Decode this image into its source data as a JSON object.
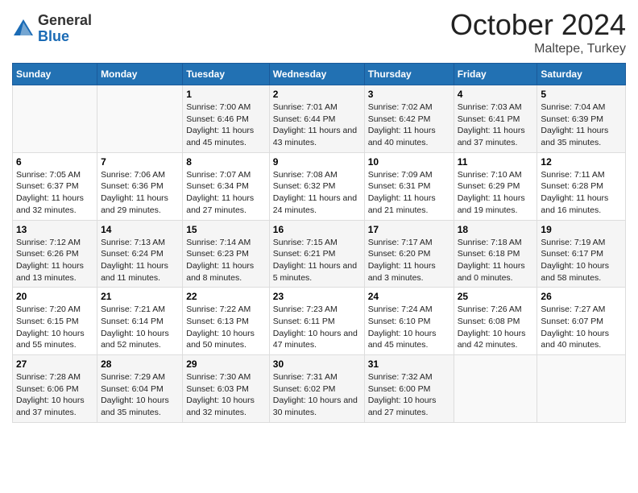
{
  "header": {
    "logo_general": "General",
    "logo_blue": "Blue",
    "month": "October 2024",
    "location": "Maltepe, Turkey"
  },
  "days_of_week": [
    "Sunday",
    "Monday",
    "Tuesday",
    "Wednesday",
    "Thursday",
    "Friday",
    "Saturday"
  ],
  "weeks": [
    [
      {
        "day": "",
        "info": ""
      },
      {
        "day": "",
        "info": ""
      },
      {
        "day": "1",
        "info": "Sunrise: 7:00 AM\nSunset: 6:46 PM\nDaylight: 11 hours and 45 minutes."
      },
      {
        "day": "2",
        "info": "Sunrise: 7:01 AM\nSunset: 6:44 PM\nDaylight: 11 hours and 43 minutes."
      },
      {
        "day": "3",
        "info": "Sunrise: 7:02 AM\nSunset: 6:42 PM\nDaylight: 11 hours and 40 minutes."
      },
      {
        "day": "4",
        "info": "Sunrise: 7:03 AM\nSunset: 6:41 PM\nDaylight: 11 hours and 37 minutes."
      },
      {
        "day": "5",
        "info": "Sunrise: 7:04 AM\nSunset: 6:39 PM\nDaylight: 11 hours and 35 minutes."
      }
    ],
    [
      {
        "day": "6",
        "info": "Sunrise: 7:05 AM\nSunset: 6:37 PM\nDaylight: 11 hours and 32 minutes."
      },
      {
        "day": "7",
        "info": "Sunrise: 7:06 AM\nSunset: 6:36 PM\nDaylight: 11 hours and 29 minutes."
      },
      {
        "day": "8",
        "info": "Sunrise: 7:07 AM\nSunset: 6:34 PM\nDaylight: 11 hours and 27 minutes."
      },
      {
        "day": "9",
        "info": "Sunrise: 7:08 AM\nSunset: 6:32 PM\nDaylight: 11 hours and 24 minutes."
      },
      {
        "day": "10",
        "info": "Sunrise: 7:09 AM\nSunset: 6:31 PM\nDaylight: 11 hours and 21 minutes."
      },
      {
        "day": "11",
        "info": "Sunrise: 7:10 AM\nSunset: 6:29 PM\nDaylight: 11 hours and 19 minutes."
      },
      {
        "day": "12",
        "info": "Sunrise: 7:11 AM\nSunset: 6:28 PM\nDaylight: 11 hours and 16 minutes."
      }
    ],
    [
      {
        "day": "13",
        "info": "Sunrise: 7:12 AM\nSunset: 6:26 PM\nDaylight: 11 hours and 13 minutes."
      },
      {
        "day": "14",
        "info": "Sunrise: 7:13 AM\nSunset: 6:24 PM\nDaylight: 11 hours and 11 minutes."
      },
      {
        "day": "15",
        "info": "Sunrise: 7:14 AM\nSunset: 6:23 PM\nDaylight: 11 hours and 8 minutes."
      },
      {
        "day": "16",
        "info": "Sunrise: 7:15 AM\nSunset: 6:21 PM\nDaylight: 11 hours and 5 minutes."
      },
      {
        "day": "17",
        "info": "Sunrise: 7:17 AM\nSunset: 6:20 PM\nDaylight: 11 hours and 3 minutes."
      },
      {
        "day": "18",
        "info": "Sunrise: 7:18 AM\nSunset: 6:18 PM\nDaylight: 11 hours and 0 minutes."
      },
      {
        "day": "19",
        "info": "Sunrise: 7:19 AM\nSunset: 6:17 PM\nDaylight: 10 hours and 58 minutes."
      }
    ],
    [
      {
        "day": "20",
        "info": "Sunrise: 7:20 AM\nSunset: 6:15 PM\nDaylight: 10 hours and 55 minutes."
      },
      {
        "day": "21",
        "info": "Sunrise: 7:21 AM\nSunset: 6:14 PM\nDaylight: 10 hours and 52 minutes."
      },
      {
        "day": "22",
        "info": "Sunrise: 7:22 AM\nSunset: 6:13 PM\nDaylight: 10 hours and 50 minutes."
      },
      {
        "day": "23",
        "info": "Sunrise: 7:23 AM\nSunset: 6:11 PM\nDaylight: 10 hours and 47 minutes."
      },
      {
        "day": "24",
        "info": "Sunrise: 7:24 AM\nSunset: 6:10 PM\nDaylight: 10 hours and 45 minutes."
      },
      {
        "day": "25",
        "info": "Sunrise: 7:26 AM\nSunset: 6:08 PM\nDaylight: 10 hours and 42 minutes."
      },
      {
        "day": "26",
        "info": "Sunrise: 7:27 AM\nSunset: 6:07 PM\nDaylight: 10 hours and 40 minutes."
      }
    ],
    [
      {
        "day": "27",
        "info": "Sunrise: 7:28 AM\nSunset: 6:06 PM\nDaylight: 10 hours and 37 minutes."
      },
      {
        "day": "28",
        "info": "Sunrise: 7:29 AM\nSunset: 6:04 PM\nDaylight: 10 hours and 35 minutes."
      },
      {
        "day": "29",
        "info": "Sunrise: 7:30 AM\nSunset: 6:03 PM\nDaylight: 10 hours and 32 minutes."
      },
      {
        "day": "30",
        "info": "Sunrise: 7:31 AM\nSunset: 6:02 PM\nDaylight: 10 hours and 30 minutes."
      },
      {
        "day": "31",
        "info": "Sunrise: 7:32 AM\nSunset: 6:00 PM\nDaylight: 10 hours and 27 minutes."
      },
      {
        "day": "",
        "info": ""
      },
      {
        "day": "",
        "info": ""
      }
    ]
  ]
}
